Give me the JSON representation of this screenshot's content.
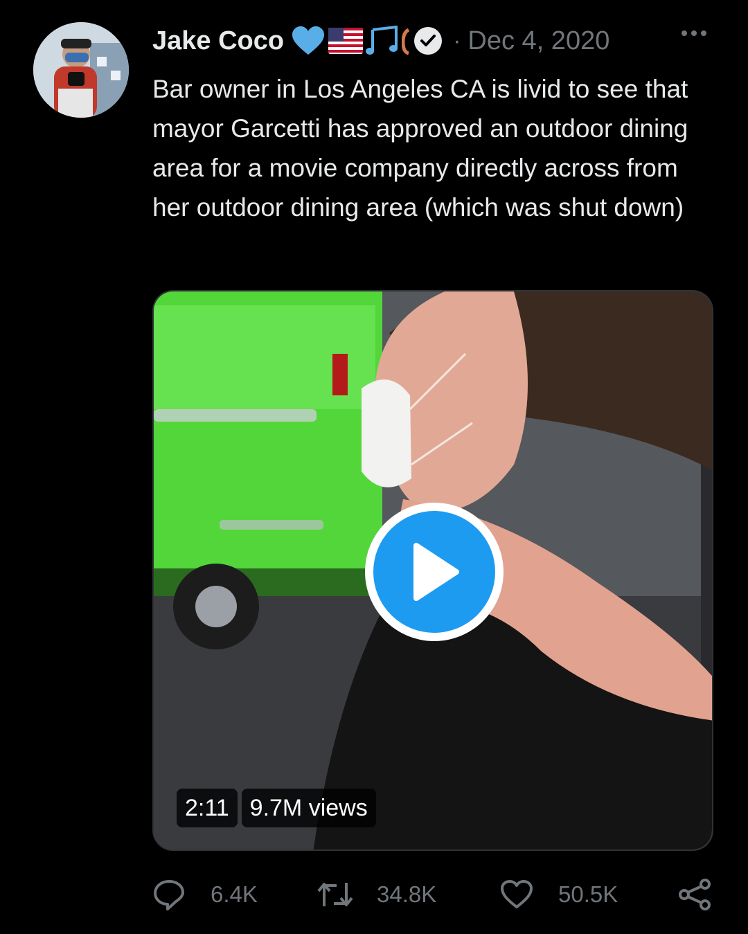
{
  "tweet": {
    "author": "Jake Coco",
    "badges": [
      "blue-heart-icon",
      "us-flag-icon",
      "music-notes-icon",
      "partial-emoji-icon",
      "verified-badge-icon"
    ],
    "separator": "·",
    "date": "Dec 4, 2020",
    "text": "Bar owner in Los Angeles CA is livid to see that mayor Garcetti has approved an outdoor dining area for a movie company directly across from her outdoor dining area (which was shut down)",
    "video": {
      "duration": "2:11",
      "views": "9.7M views"
    },
    "actions": {
      "replies": "6.4K",
      "retweets": "34.8K",
      "likes": "50.5K"
    }
  },
  "colors": {
    "background": "#000000",
    "text": "#e7e9ea",
    "muted": "#71767b",
    "accent": "#1d9bf0"
  }
}
